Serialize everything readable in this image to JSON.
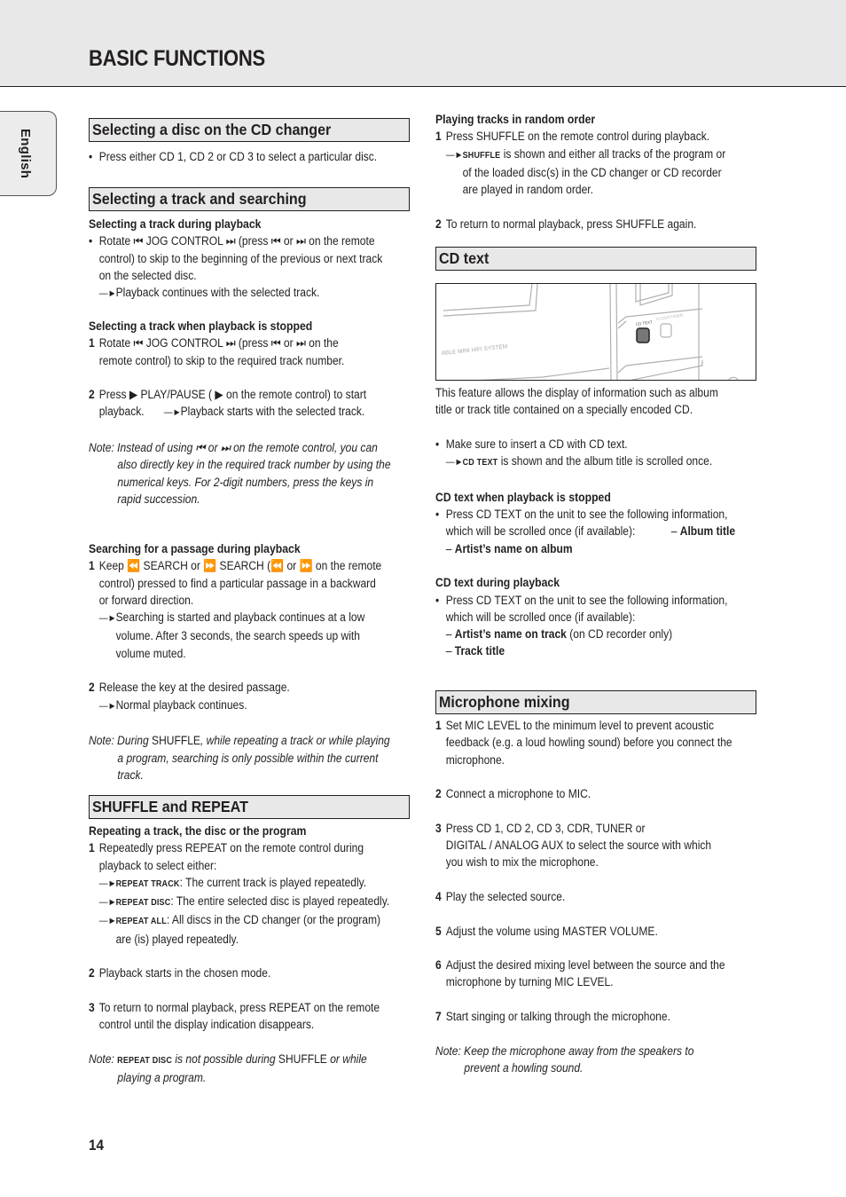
{
  "header": {
    "title": "BASIC FUNCTIONS"
  },
  "language_tab": "English",
  "page_number": "14",
  "left": {
    "sec1": {
      "title": "Selecting a disc on the CD changer",
      "bullet": "Press either CD 1, CD 2 or CD 3 to select a particular disc."
    },
    "sec2": {
      "title": "Selecting a track and searching",
      "sub1": {
        "title": "Selecting a track during playback",
        "lines": [
          "Rotate ⏮ JOG CONTROL ⏭ (press ⏮ or ⏭ on the remote",
          "control) to skip to the beginning of the previous or next track",
          "on the selected disc."
        ],
        "result": "Playback continues with the selected track."
      },
      "sub2": {
        "title": "Selecting a track when playback is stopped",
        "step1": [
          "Rotate ⏮ JOG CONTROL ⏭ (press ⏮ or ⏭ on the",
          "remote control) to skip to the required track number."
        ],
        "step2": [
          "Press ▶ PLAY/PAUSE ( ▶ on the remote control) to start",
          "playback."
        ],
        "step2_result": "Playback starts with the selected track.",
        "note": [
          "Instead of using ⏮ or ⏭ on the remote control, you can",
          "also directly key in the required track number by using the",
          "numerical keys. For 2-digit numbers, press the keys in",
          "rapid succession."
        ]
      },
      "sub3": {
        "title": "Searching for a passage during playback",
        "step1": [
          "Keep ⏪ SEARCH or ⏩ SEARCH (⏪ or ⏩ on the remote",
          "control) pressed to find a particular passage in a backward",
          "or forward direction."
        ],
        "step1_result": [
          "Searching is started and playback continues at a low",
          "volume. After 3 seconds, the search speeds up with",
          "volume muted."
        ],
        "step2": "Release the key at the desired passage.",
        "step2_result": "Normal playback continues.",
        "note_a": "During",
        "note_b": " SHUFFLE",
        "note_c": ", while repeating a track or while playing",
        "note_lines": [
          "a program, searching is only possible within the current",
          "track."
        ]
      }
    },
    "sec3": {
      "title": "SHUFFLE and REPEAT",
      "sub1": {
        "title": "Repeating a track, the disc or the program",
        "step1": [
          "Repeatedly press REPEAT on the remote control during",
          "playback to select either:"
        ],
        "modes": [
          {
            "label": "REPEAT TRACK",
            "text": ": The current track is played repeatedly."
          },
          {
            "label": "REPEAT DISC",
            "text": ": The entire selected disc is played repeatedly."
          },
          {
            "label": "REPEAT ALL",
            "text": ": All discs in the CD changer (or the program)"
          }
        ],
        "mode_cont": "are (is) played repeatedly.",
        "step2": "Playback starts in the chosen mode.",
        "step3": [
          "To return to normal playback, press REPEAT on the remote",
          "control until the display indication disappears."
        ],
        "note_label": "REPEAT DISC",
        "note_a": " is not possible during",
        "note_b": " SHUFFLE",
        "note_c": " or while",
        "note_cont": "playing a program."
      }
    }
  },
  "right": {
    "shuffle": {
      "title": "Playing tracks in random order",
      "step1": "Press SHUFFLE on the remote control during playback.",
      "step1_label": "SHUFFLE",
      "step1_result": [
        " is shown and either all tracks of the program or",
        "of the loaded disc(s) in the CD changer or CD recorder",
        "are played in random order."
      ],
      "step2": "To return to normal playback, press SHUFFLE again."
    },
    "cdtext": {
      "title": "CD text",
      "figure": {
        "brand_text": "ABLE MINI HIFI SYSTEM",
        "button1": "CD TEXT",
        "button2": "CLOCK/TIMER"
      },
      "intro": [
        "This feature allows the display of information such as album",
        "title or track title contained on a specially encoded CD."
      ],
      "bullet": "Make sure to insert a CD with CD text.",
      "result_label": "CD TEXT",
      "result_text": " is shown and the album title is scrolled once.",
      "stopped": {
        "title": "CD text when playback is stopped",
        "lines": [
          "Press CD TEXT on the unit to see the following information,",
          "which will be scrolled once (if available):"
        ],
        "items": [
          "Album title",
          "Artist’s name on album"
        ]
      },
      "playing": {
        "title": "CD text during playback",
        "lines": [
          "Press CD TEXT on the unit to see the following information,",
          "which will be scrolled once (if available):"
        ],
        "item1": "Artist’s name on track",
        "item1_suffix": " (on CD recorder only)",
        "item2": "Track title"
      }
    },
    "mic": {
      "title": "Microphone mixing",
      "steps": [
        [
          "Set MIC LEVEL to the minimum level to prevent acoustic",
          "feedback (e.g. a loud howling sound) before you connect the",
          "microphone."
        ],
        [
          "Connect a microphone to MIC."
        ],
        [
          "Press CD 1, CD 2, CD 3, CDR, TUNER or",
          "DIGITAL / ANALOG AUX to select the source with which",
          "you wish to mix the microphone."
        ],
        [
          "Play the selected source."
        ],
        [
          "Adjust the volume using MASTER VOLUME."
        ],
        [
          "Adjust the desired mixing level between the source and the",
          "microphone by turning MIC LEVEL."
        ],
        [
          "Start singing or talking through the microphone."
        ]
      ],
      "note": [
        "Keep the microphone away from the speakers to",
        "prevent a howling sound."
      ]
    },
    "note_prefix": "Note:"
  },
  "symbols": {
    "bullet": "•",
    "arrow": "—►",
    "dash": "– "
  }
}
